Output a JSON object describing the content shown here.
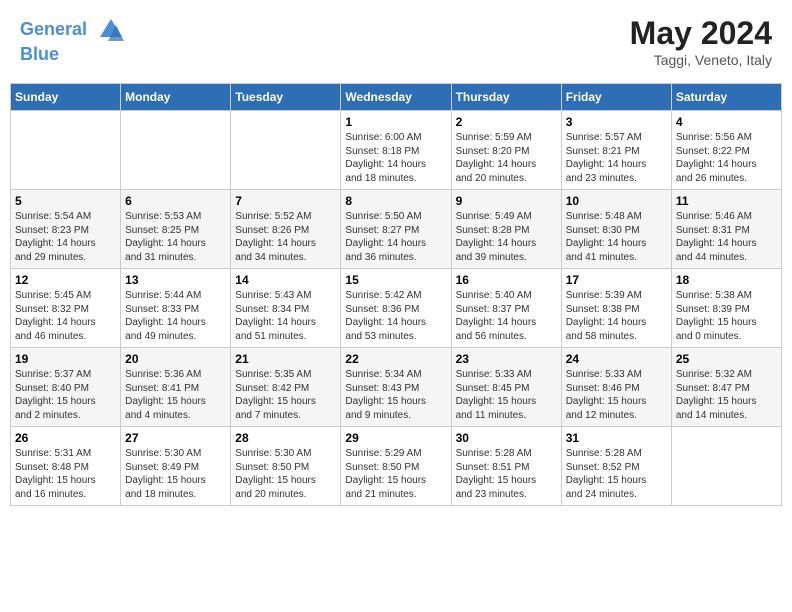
{
  "header": {
    "logo_line1": "General",
    "logo_line2": "Blue",
    "title": "May 2024",
    "subtitle": "Taggi, Veneto, Italy"
  },
  "weekdays": [
    "Sunday",
    "Monday",
    "Tuesday",
    "Wednesday",
    "Thursday",
    "Friday",
    "Saturday"
  ],
  "weeks": [
    [
      {
        "day": "",
        "info": ""
      },
      {
        "day": "",
        "info": ""
      },
      {
        "day": "",
        "info": ""
      },
      {
        "day": "1",
        "info": "Sunrise: 6:00 AM\nSunset: 8:18 PM\nDaylight: 14 hours\nand 18 minutes."
      },
      {
        "day": "2",
        "info": "Sunrise: 5:59 AM\nSunset: 8:20 PM\nDaylight: 14 hours\nand 20 minutes."
      },
      {
        "day": "3",
        "info": "Sunrise: 5:57 AM\nSunset: 8:21 PM\nDaylight: 14 hours\nand 23 minutes."
      },
      {
        "day": "4",
        "info": "Sunrise: 5:56 AM\nSunset: 8:22 PM\nDaylight: 14 hours\nand 26 minutes."
      }
    ],
    [
      {
        "day": "5",
        "info": "Sunrise: 5:54 AM\nSunset: 8:23 PM\nDaylight: 14 hours\nand 29 minutes."
      },
      {
        "day": "6",
        "info": "Sunrise: 5:53 AM\nSunset: 8:25 PM\nDaylight: 14 hours\nand 31 minutes."
      },
      {
        "day": "7",
        "info": "Sunrise: 5:52 AM\nSunset: 8:26 PM\nDaylight: 14 hours\nand 34 minutes."
      },
      {
        "day": "8",
        "info": "Sunrise: 5:50 AM\nSunset: 8:27 PM\nDaylight: 14 hours\nand 36 minutes."
      },
      {
        "day": "9",
        "info": "Sunrise: 5:49 AM\nSunset: 8:28 PM\nDaylight: 14 hours\nand 39 minutes."
      },
      {
        "day": "10",
        "info": "Sunrise: 5:48 AM\nSunset: 8:30 PM\nDaylight: 14 hours\nand 41 minutes."
      },
      {
        "day": "11",
        "info": "Sunrise: 5:46 AM\nSunset: 8:31 PM\nDaylight: 14 hours\nand 44 minutes."
      }
    ],
    [
      {
        "day": "12",
        "info": "Sunrise: 5:45 AM\nSunset: 8:32 PM\nDaylight: 14 hours\nand 46 minutes."
      },
      {
        "day": "13",
        "info": "Sunrise: 5:44 AM\nSunset: 8:33 PM\nDaylight: 14 hours\nand 49 minutes."
      },
      {
        "day": "14",
        "info": "Sunrise: 5:43 AM\nSunset: 8:34 PM\nDaylight: 14 hours\nand 51 minutes."
      },
      {
        "day": "15",
        "info": "Sunrise: 5:42 AM\nSunset: 8:36 PM\nDaylight: 14 hours\nand 53 minutes."
      },
      {
        "day": "16",
        "info": "Sunrise: 5:40 AM\nSunset: 8:37 PM\nDaylight: 14 hours\nand 56 minutes."
      },
      {
        "day": "17",
        "info": "Sunrise: 5:39 AM\nSunset: 8:38 PM\nDaylight: 14 hours\nand 58 minutes."
      },
      {
        "day": "18",
        "info": "Sunrise: 5:38 AM\nSunset: 8:39 PM\nDaylight: 15 hours\nand 0 minutes."
      }
    ],
    [
      {
        "day": "19",
        "info": "Sunrise: 5:37 AM\nSunset: 8:40 PM\nDaylight: 15 hours\nand 2 minutes."
      },
      {
        "day": "20",
        "info": "Sunrise: 5:36 AM\nSunset: 8:41 PM\nDaylight: 15 hours\nand 4 minutes."
      },
      {
        "day": "21",
        "info": "Sunrise: 5:35 AM\nSunset: 8:42 PM\nDaylight: 15 hours\nand 7 minutes."
      },
      {
        "day": "22",
        "info": "Sunrise: 5:34 AM\nSunset: 8:43 PM\nDaylight: 15 hours\nand 9 minutes."
      },
      {
        "day": "23",
        "info": "Sunrise: 5:33 AM\nSunset: 8:45 PM\nDaylight: 15 hours\nand 11 minutes."
      },
      {
        "day": "24",
        "info": "Sunrise: 5:33 AM\nSunset: 8:46 PM\nDaylight: 15 hours\nand 12 minutes."
      },
      {
        "day": "25",
        "info": "Sunrise: 5:32 AM\nSunset: 8:47 PM\nDaylight: 15 hours\nand 14 minutes."
      }
    ],
    [
      {
        "day": "26",
        "info": "Sunrise: 5:31 AM\nSunset: 8:48 PM\nDaylight: 15 hours\nand 16 minutes."
      },
      {
        "day": "27",
        "info": "Sunrise: 5:30 AM\nSunset: 8:49 PM\nDaylight: 15 hours\nand 18 minutes."
      },
      {
        "day": "28",
        "info": "Sunrise: 5:30 AM\nSunset: 8:50 PM\nDaylight: 15 hours\nand 20 minutes."
      },
      {
        "day": "29",
        "info": "Sunrise: 5:29 AM\nSunset: 8:50 PM\nDaylight: 15 hours\nand 21 minutes."
      },
      {
        "day": "30",
        "info": "Sunrise: 5:28 AM\nSunset: 8:51 PM\nDaylight: 15 hours\nand 23 minutes."
      },
      {
        "day": "31",
        "info": "Sunrise: 5:28 AM\nSunset: 8:52 PM\nDaylight: 15 hours\nand 24 minutes."
      },
      {
        "day": "",
        "info": ""
      }
    ]
  ]
}
